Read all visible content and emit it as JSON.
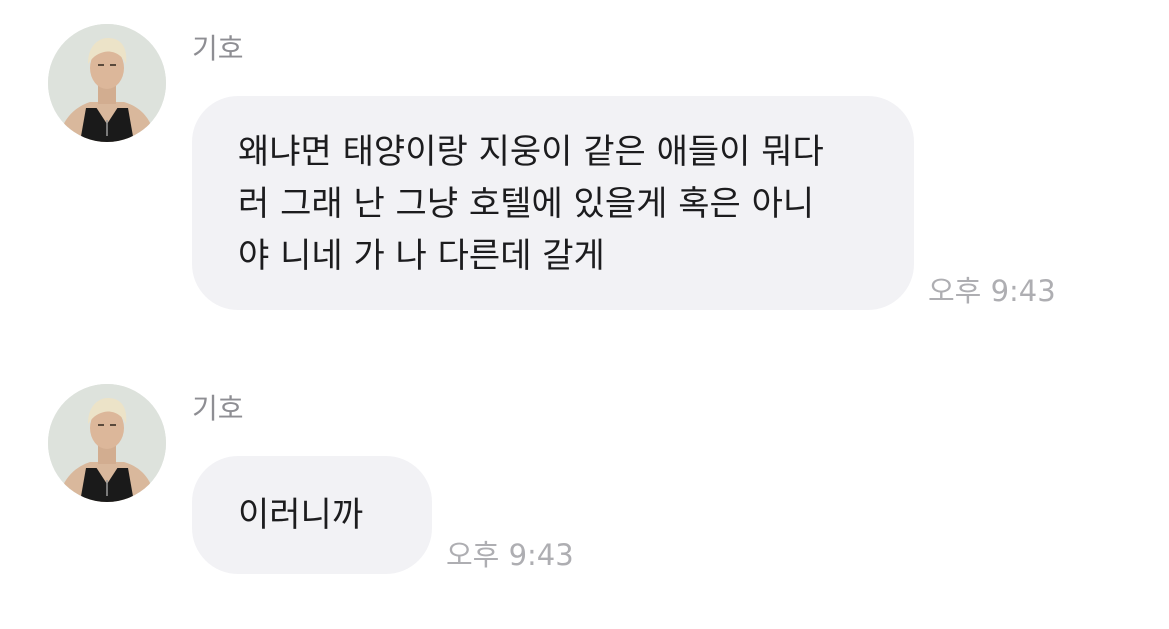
{
  "messages": [
    {
      "sender": "기호",
      "text": "왜냐면 태양이랑 지웅이 같은 애들이 뭐다\n러 그래 난 그냥 호텔에 있을게 혹은 아니\n야 니네 가 나 다른데 갈게",
      "time": "오후 9:43",
      "avatar": "profile-photo"
    },
    {
      "sender": "기호",
      "text": "이러니까",
      "time": "오후 9:43",
      "avatar": "profile-photo"
    }
  ],
  "colors": {
    "bubble_bg": "#f2f2f5",
    "sender_text": "#8e8e93",
    "time_text": "#aeaeb2",
    "message_text": "#1c1c1e"
  }
}
